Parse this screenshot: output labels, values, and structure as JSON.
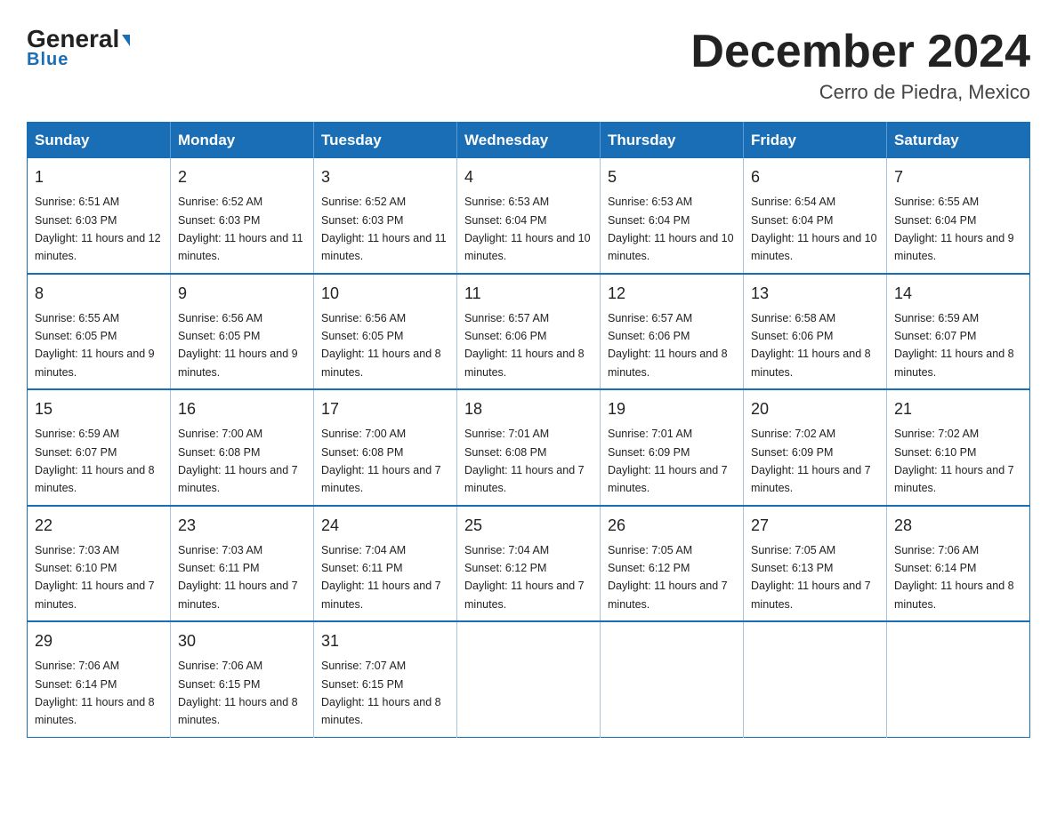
{
  "header": {
    "logo_general": "General",
    "logo_blue": "Blue",
    "month_title": "December 2024",
    "subtitle": "Cerro de Piedra, Mexico"
  },
  "weekdays": [
    "Sunday",
    "Monday",
    "Tuesday",
    "Wednesday",
    "Thursday",
    "Friday",
    "Saturday"
  ],
  "weeks": [
    [
      {
        "day": "1",
        "sunrise": "6:51 AM",
        "sunset": "6:03 PM",
        "daylight": "11 hours and 12 minutes."
      },
      {
        "day": "2",
        "sunrise": "6:52 AM",
        "sunset": "6:03 PM",
        "daylight": "11 hours and 11 minutes."
      },
      {
        "day": "3",
        "sunrise": "6:52 AM",
        "sunset": "6:03 PM",
        "daylight": "11 hours and 11 minutes."
      },
      {
        "day": "4",
        "sunrise": "6:53 AM",
        "sunset": "6:04 PM",
        "daylight": "11 hours and 10 minutes."
      },
      {
        "day": "5",
        "sunrise": "6:53 AM",
        "sunset": "6:04 PM",
        "daylight": "11 hours and 10 minutes."
      },
      {
        "day": "6",
        "sunrise": "6:54 AM",
        "sunset": "6:04 PM",
        "daylight": "11 hours and 10 minutes."
      },
      {
        "day": "7",
        "sunrise": "6:55 AM",
        "sunset": "6:04 PM",
        "daylight": "11 hours and 9 minutes."
      }
    ],
    [
      {
        "day": "8",
        "sunrise": "6:55 AM",
        "sunset": "6:05 PM",
        "daylight": "11 hours and 9 minutes."
      },
      {
        "day": "9",
        "sunrise": "6:56 AM",
        "sunset": "6:05 PM",
        "daylight": "11 hours and 9 minutes."
      },
      {
        "day": "10",
        "sunrise": "6:56 AM",
        "sunset": "6:05 PM",
        "daylight": "11 hours and 8 minutes."
      },
      {
        "day": "11",
        "sunrise": "6:57 AM",
        "sunset": "6:06 PM",
        "daylight": "11 hours and 8 minutes."
      },
      {
        "day": "12",
        "sunrise": "6:57 AM",
        "sunset": "6:06 PM",
        "daylight": "11 hours and 8 minutes."
      },
      {
        "day": "13",
        "sunrise": "6:58 AM",
        "sunset": "6:06 PM",
        "daylight": "11 hours and 8 minutes."
      },
      {
        "day": "14",
        "sunrise": "6:59 AM",
        "sunset": "6:07 PM",
        "daylight": "11 hours and 8 minutes."
      }
    ],
    [
      {
        "day": "15",
        "sunrise": "6:59 AM",
        "sunset": "6:07 PM",
        "daylight": "11 hours and 8 minutes."
      },
      {
        "day": "16",
        "sunrise": "7:00 AM",
        "sunset": "6:08 PM",
        "daylight": "11 hours and 7 minutes."
      },
      {
        "day": "17",
        "sunrise": "7:00 AM",
        "sunset": "6:08 PM",
        "daylight": "11 hours and 7 minutes."
      },
      {
        "day": "18",
        "sunrise": "7:01 AM",
        "sunset": "6:08 PM",
        "daylight": "11 hours and 7 minutes."
      },
      {
        "day": "19",
        "sunrise": "7:01 AM",
        "sunset": "6:09 PM",
        "daylight": "11 hours and 7 minutes."
      },
      {
        "day": "20",
        "sunrise": "7:02 AM",
        "sunset": "6:09 PM",
        "daylight": "11 hours and 7 minutes."
      },
      {
        "day": "21",
        "sunrise": "7:02 AM",
        "sunset": "6:10 PM",
        "daylight": "11 hours and 7 minutes."
      }
    ],
    [
      {
        "day": "22",
        "sunrise": "7:03 AM",
        "sunset": "6:10 PM",
        "daylight": "11 hours and 7 minutes."
      },
      {
        "day": "23",
        "sunrise": "7:03 AM",
        "sunset": "6:11 PM",
        "daylight": "11 hours and 7 minutes."
      },
      {
        "day": "24",
        "sunrise": "7:04 AM",
        "sunset": "6:11 PM",
        "daylight": "11 hours and 7 minutes."
      },
      {
        "day": "25",
        "sunrise": "7:04 AM",
        "sunset": "6:12 PM",
        "daylight": "11 hours and 7 minutes."
      },
      {
        "day": "26",
        "sunrise": "7:05 AM",
        "sunset": "6:12 PM",
        "daylight": "11 hours and 7 minutes."
      },
      {
        "day": "27",
        "sunrise": "7:05 AM",
        "sunset": "6:13 PM",
        "daylight": "11 hours and 7 minutes."
      },
      {
        "day": "28",
        "sunrise": "7:06 AM",
        "sunset": "6:14 PM",
        "daylight": "11 hours and 8 minutes."
      }
    ],
    [
      {
        "day": "29",
        "sunrise": "7:06 AM",
        "sunset": "6:14 PM",
        "daylight": "11 hours and 8 minutes."
      },
      {
        "day": "30",
        "sunrise": "7:06 AM",
        "sunset": "6:15 PM",
        "daylight": "11 hours and 8 minutes."
      },
      {
        "day": "31",
        "sunrise": "7:07 AM",
        "sunset": "6:15 PM",
        "daylight": "11 hours and 8 minutes."
      },
      null,
      null,
      null,
      null
    ]
  ]
}
